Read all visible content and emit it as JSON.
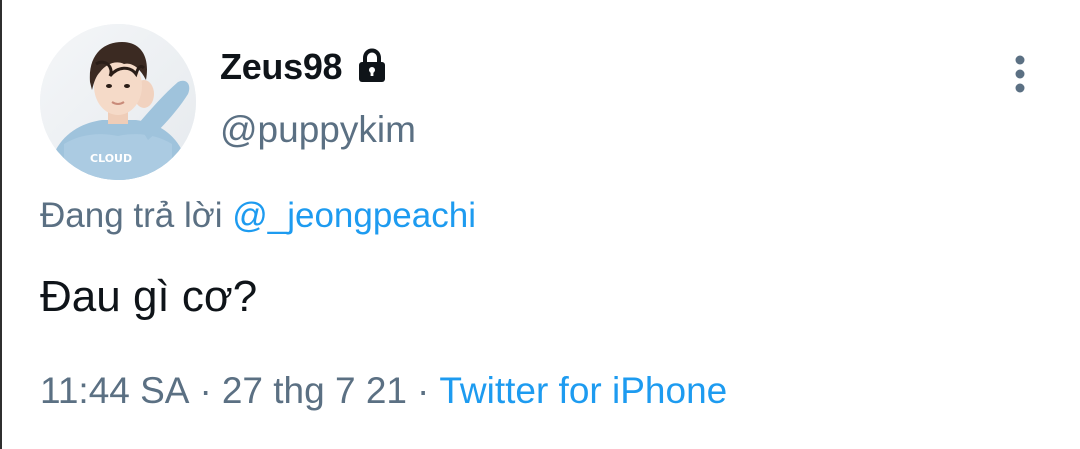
{
  "tweet": {
    "author": {
      "display_name": "Zeus98",
      "handle": "@puppykim",
      "avatar_icon": "profile-photo",
      "protected_icon": "lock-icon"
    },
    "reply": {
      "prefix": "Đang trả lời",
      "mention": "@_jeongpeachi"
    },
    "text": "Đau gì cơ?",
    "meta": {
      "time": "11:44 SA",
      "separator": "·",
      "date": "27 thg 7 21",
      "source": "Twitter for iPhone"
    },
    "more_icon": "more-vertical-icon"
  },
  "colors": {
    "text_primary": "#0f1419",
    "text_secondary": "#5b7083",
    "accent": "#1d9bf0",
    "background": "#ffffff"
  }
}
